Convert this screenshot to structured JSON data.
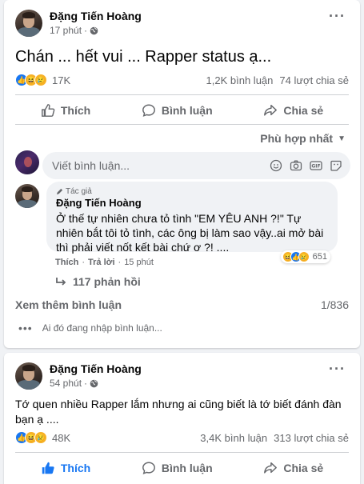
{
  "posts": [
    {
      "author": "Đặng Tiến Hoàng",
      "time": "17 phút",
      "privacy_icon": "globe-icon",
      "text": "Chán ... hết vui ... Rapper status ạ...",
      "reaction_count": "17K",
      "comments": "1,2K bình luận",
      "shares": "74 lượt chia sẻ",
      "actions": {
        "like": "Thích",
        "comment": "Bình luận",
        "share": "Chia sẻ"
      },
      "liked": false,
      "sort_label": "Phù hợp nhất",
      "comment_placeholder": "Viết bình luận...",
      "top_comment": {
        "badge": "Tác giả",
        "author": "Đặng Tiến Hoàng",
        "text": "Ở thế tự nhiên chưa tỏ tình \"EM YÊU ANH ?!\" Tự nhiên bắt tôi tỏ tình, các ông bị làm sao vậy..ai mở bài thì phải viết nốt kết bài chứ ơ ?! ....",
        "like": "Thích",
        "reply": "Trả lời",
        "time": "15 phút",
        "reactions": "651",
        "replies": "117 phản hồi"
      },
      "more_comments": "Xem thêm bình luận",
      "comment_pager": "1/836",
      "typing": "Ai đó đang nhập bình luận..."
    },
    {
      "author": "Đặng Tiến Hoàng",
      "time": "54 phút",
      "privacy_icon": "globe-icon",
      "text": "Tớ quen nhiều Rapper lắm nhưng ai cũng biết là tớ biết đánh đàn bạn ạ ....",
      "reaction_count": "48K",
      "comments": "3,4K bình luận",
      "shares": "313 lượt chia sẻ",
      "actions": {
        "like": "Thích",
        "comment": "Bình luận",
        "share": "Chia sẻ"
      },
      "liked": true
    }
  ],
  "colors": {
    "accent": "#1877f2",
    "secondary_text": "#65676b",
    "background": "#f0f2f5"
  }
}
